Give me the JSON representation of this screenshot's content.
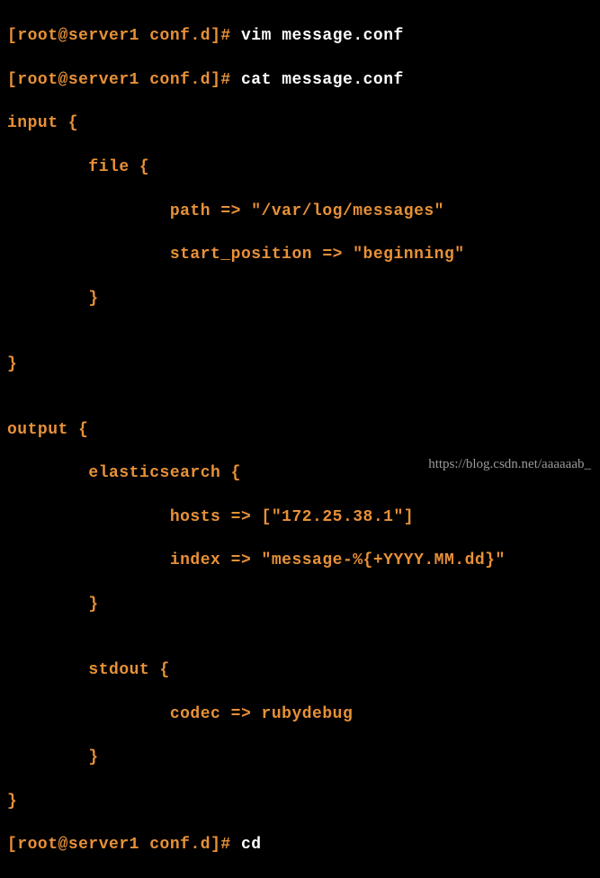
{
  "prompt": {
    "bracket_open": "[",
    "user_host": "root@server1",
    "path": "conf.d",
    "bracket_close": "]",
    "symbol": "#"
  },
  "commands": {
    "line1_cmd": "vim",
    "line1_arg": "message.conf",
    "line2_cmd": "cat",
    "line2_arg": "message.conf",
    "last_cmd": "cd"
  },
  "config": {
    "l1": "input {",
    "l2": "        file {",
    "l3": "                path => \"/var/log/messages\"",
    "l4": "                start_position => \"beginning\"",
    "l5": "        }",
    "l6": "",
    "l7": "}",
    "l8": "",
    "l9": "output {",
    "l10": "        elasticsearch {",
    "l11": "                hosts => [\"172.25.38.1\"]",
    "l12": "                index => \"message-%{+YYYY.MM.dd}\"",
    "l13": "        }",
    "l14": "",
    "l15": "        stdout {",
    "l16": "                codec => rubydebug",
    "l17": "        }",
    "l18": "}"
  },
  "watermark": "https://blog.csdn.net/aaaaaab_"
}
